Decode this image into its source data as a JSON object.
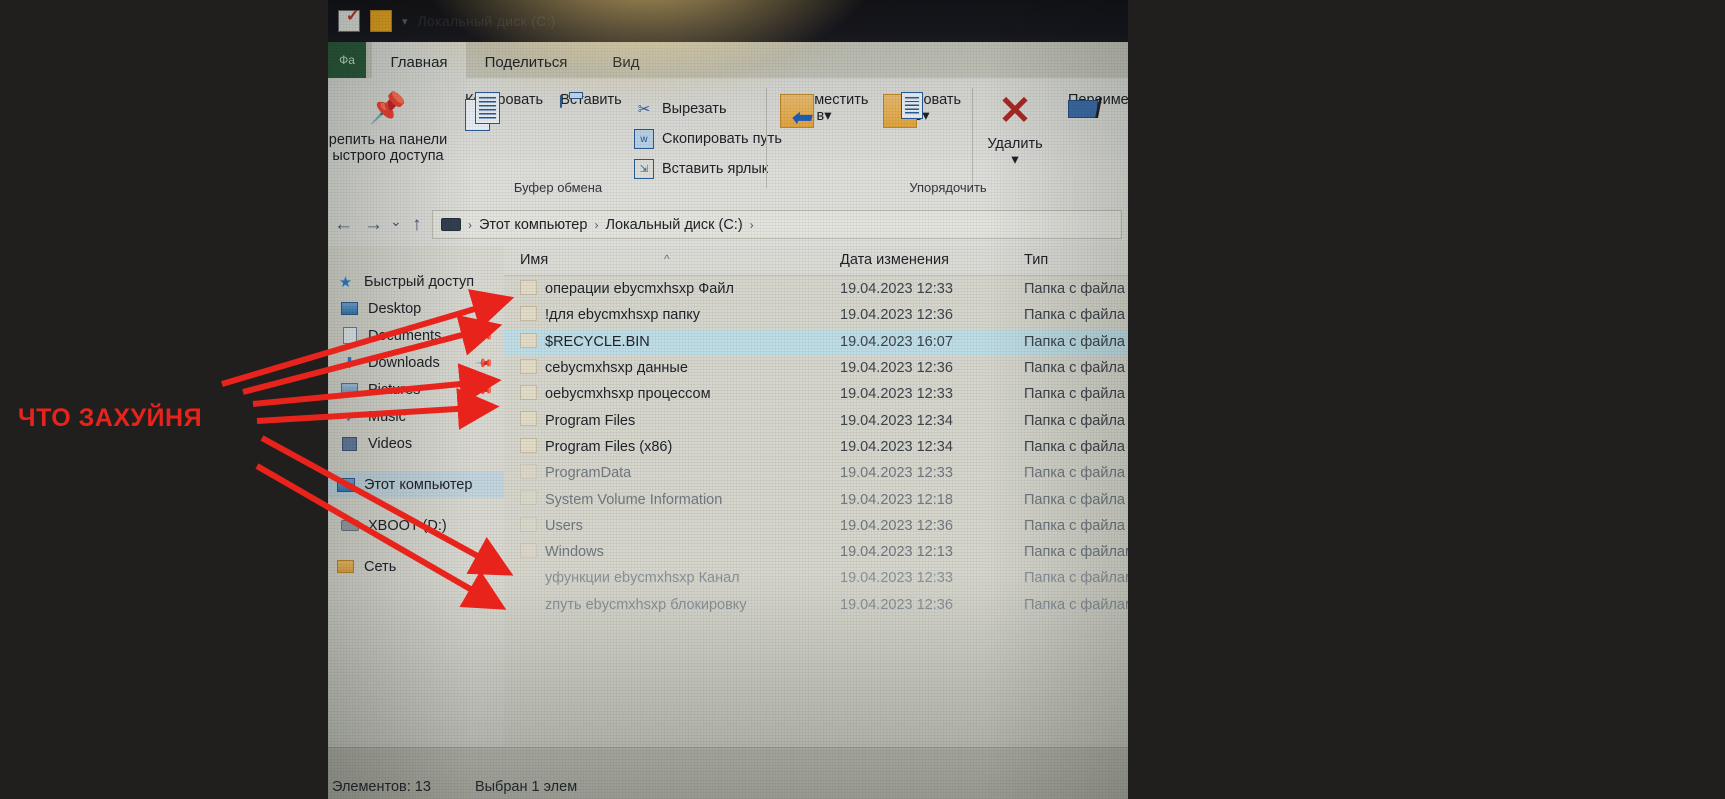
{
  "titlebar": {
    "title": "Локальный диск (C:)",
    "caret": "▾"
  },
  "ribbon": {
    "file_tab": "Фа",
    "tabs": [
      {
        "label": "Главная",
        "active": true
      },
      {
        "label": "Поделиться",
        "active": false
      },
      {
        "label": "Вид",
        "active": false
      }
    ],
    "pin_label_line1": "репить на панели",
    "pin_label_line2": "ыстрого доступа",
    "copy_label": "Копировать",
    "paste_label": "Вставить",
    "cut_label": "Вырезать",
    "copy_path_label": "Скопировать путь",
    "paste_shortcut_label": "Вставить ярлык",
    "clipboard_group": "Буфер обмена",
    "move_to_label": "Переместить",
    "move_to_sub": "в",
    "copy_to_label": "Копировать",
    "copy_to_sub": "в",
    "delete_label": "Удалить",
    "rename_label": "Переименова",
    "organize_group": "Упорядочить",
    "dropdown_caret": "▾"
  },
  "addressbar": {
    "back": "←",
    "forward": "→",
    "recent": "⌄",
    "up": "↑",
    "crumbs": [
      "Этот компьютер",
      "Локальный диск (C:)"
    ],
    "separator": "›"
  },
  "columns": {
    "name": "Имя",
    "date": "Дата изменения",
    "type": "Тип",
    "sort_indicator": "^"
  },
  "sidebar": {
    "items": [
      {
        "label": "Быстрый доступ",
        "icon": "star-icon",
        "pinned": false,
        "group": true
      },
      {
        "label": "Desktop",
        "icon": "desktop-icon",
        "pinned": true
      },
      {
        "label": "Documents",
        "icon": "documents-icon",
        "pinned": true
      },
      {
        "label": "Downloads",
        "icon": "downloads-icon",
        "pinned": true
      },
      {
        "label": "Pictures",
        "icon": "pictures-icon",
        "pinned": true
      },
      {
        "label": "Music",
        "icon": "music-icon",
        "pinned": false
      },
      {
        "label": "Videos",
        "icon": "videos-icon",
        "pinned": false
      },
      {
        "label": "Этот компьютер",
        "icon": "this-pc-icon",
        "pinned": false,
        "group": true,
        "selected": true
      },
      {
        "label": "XBOOT (D:)",
        "icon": "drive-icon",
        "pinned": false
      },
      {
        "label": "Сеть",
        "icon": "network-icon",
        "pinned": false,
        "group": true
      }
    ]
  },
  "files": {
    "rows": [
      {
        "name": "операции ebycmxhsxp Файл",
        "date": "19.04.2023 12:33",
        "type": "Папка с файла",
        "selected": false,
        "dim": 0
      },
      {
        "name": "!для ebycmxhsxp папку",
        "date": "19.04.2023 12:36",
        "type": "Папка с файла",
        "selected": false,
        "dim": 0
      },
      {
        "name": "$RECYCLE.BIN",
        "date": "19.04.2023 16:07",
        "type": "Папка с файла",
        "selected": true,
        "dim": 0
      },
      {
        "name": "cebycmxhsxp данные",
        "date": "19.04.2023 12:36",
        "type": "Папка с файла",
        "selected": false,
        "dim": 0
      },
      {
        "name": "oebycmxhsxp процессом",
        "date": "19.04.2023 12:33",
        "type": "Папка с файла",
        "selected": false,
        "dim": 0
      },
      {
        "name": "Program Files",
        "date": "19.04.2023 12:34",
        "type": "Папка с файла",
        "selected": false,
        "dim": 0
      },
      {
        "name": "Program Files (x86)",
        "date": "19.04.2023 12:34",
        "type": "Папка с файла",
        "selected": false,
        "dim": 0
      },
      {
        "name": "ProgramData",
        "date": "19.04.2023 12:33",
        "type": "Папка с файла",
        "selected": false,
        "dim": 1
      },
      {
        "name": "System Volume Information",
        "date": "19.04.2023 12:18",
        "type": "Папка с файла",
        "selected": false,
        "dim": 1
      },
      {
        "name": "Users",
        "date": "19.04.2023 12:36",
        "type": "Папка с файла",
        "selected": false,
        "dim": 1
      },
      {
        "name": "Windows",
        "date": "19.04.2023 12:13",
        "type": "Папка с файлам",
        "selected": false,
        "dim": 1
      },
      {
        "name": "уфункции ebycmxhsxp Канал",
        "date": "19.04.2023 12:33",
        "type": "Папка с файлам",
        "selected": false,
        "dim": 2
      },
      {
        "name": "zпуть ebycmxhsxp блокировку",
        "date": "19.04.2023 12:36",
        "type": "Папка с файлам",
        "selected": false,
        "dim": 2
      }
    ]
  },
  "statusbar": {
    "count": "Элементов: 13",
    "selection": "Выбран 1 элем"
  },
  "annotation": {
    "text": "ЧТО ЗАХУЙНЯ",
    "color": "#e8231b"
  }
}
